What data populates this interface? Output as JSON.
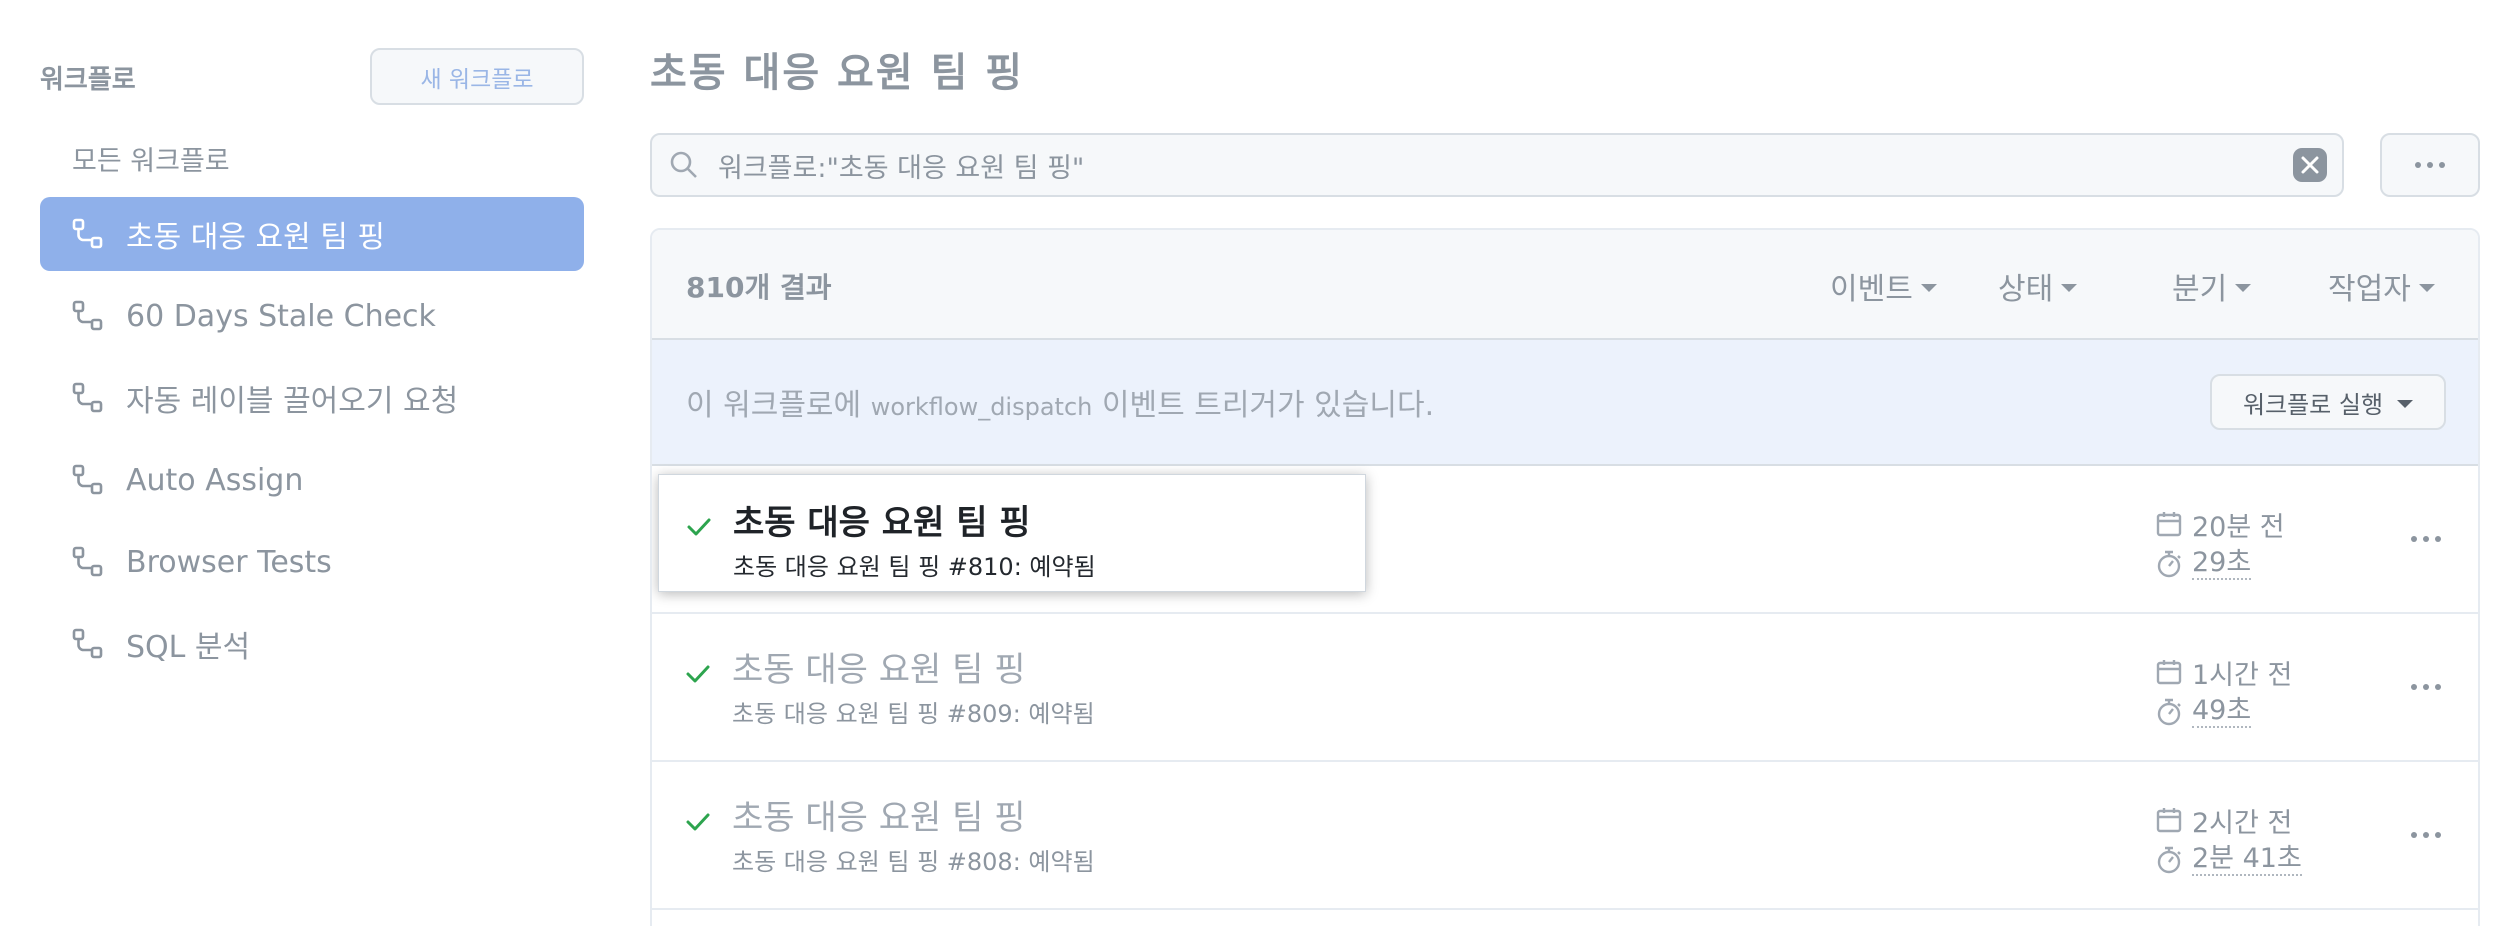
{
  "sidebar": {
    "title": "워크플로",
    "new_button": "새 워크플로",
    "all_label": "모든 워크플로",
    "items": [
      {
        "label": "초동 대응 요원 팀 핑",
        "active": true
      },
      {
        "label": "60 Days Stale Check",
        "active": false
      },
      {
        "label": "자동 레이블 끌어오기 요청",
        "active": false
      },
      {
        "label": "Auto Assign",
        "active": false
      },
      {
        "label": "Browser Tests",
        "active": false
      },
      {
        "label": "SQL 분석",
        "active": false
      }
    ]
  },
  "main": {
    "title": "초동 대응 요원 팀 핑",
    "search": {
      "value": "워크플로:\"초동 대응 요원 팀 핑\""
    },
    "results_count": "810개 결과",
    "filters": {
      "event": "이벤트",
      "status": "상태",
      "branch": "분기",
      "actor": "작업자"
    },
    "dispatch": {
      "prefix": "이 워크플로에 ",
      "code": "workflow_dispatch",
      "suffix": " 이벤트 트리거가 있습니다.",
      "run_button": "워크플로 실행"
    },
    "runs": [
      {
        "name": "초동 대응 요원 팀 핑",
        "sub": "초동 대응 요원 팀 핑 #810: 예약됨",
        "time": "20분 전",
        "duration": "29초",
        "highlight": true
      },
      {
        "name": "초동 대응 요원 팀 핑",
        "sub": "초동 대응 요원 팀 핑 #809: 예약됨",
        "time": "1시간 전",
        "duration": "49초",
        "highlight": false
      },
      {
        "name": "초동 대응 요원 팀 핑",
        "sub": "초동 대응 요원 팀 핑 #808: 예약됨",
        "time": "2시간 전",
        "duration": "2분 41초",
        "highlight": false
      }
    ]
  },
  "colors": {
    "accent": "#8fb0ea",
    "success": "#2da44e",
    "muted": "#8c959f"
  },
  "icons": {
    "workflow": "workflow-icon",
    "search": "search-icon",
    "clear": "clear-icon",
    "kebab": "kebab-icon",
    "check": "check-icon",
    "calendar": "calendar-icon",
    "stopwatch": "stopwatch-icon"
  }
}
